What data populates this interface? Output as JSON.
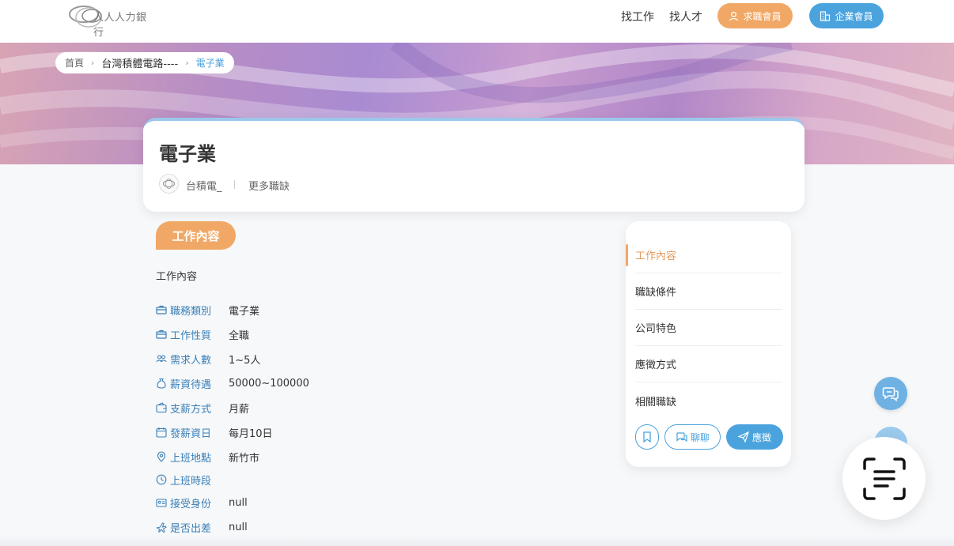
{
  "header": {
    "logo_text": "人人人力銀行",
    "nav_find_job": "找工作",
    "nav_find_talent": "找人才",
    "btn_job_seeker": "求職會員",
    "btn_company": "企業會員"
  },
  "breadcrumb": {
    "home": "首頁",
    "company": "台灣積體電路----",
    "current": "電子業"
  },
  "job": {
    "title": "電子業",
    "company": "台積電_",
    "more_jobs": "更多職缺"
  },
  "section": {
    "tag": "工作內容",
    "subtitle": "工作內容"
  },
  "details": [
    {
      "label": "職務類別",
      "value": "電子業",
      "icon": "briefcase-icon"
    },
    {
      "label": "工作性質",
      "value": "全職",
      "icon": "briefcase-icon"
    },
    {
      "label": "需求人數",
      "value": "1~5人",
      "icon": "people-icon"
    },
    {
      "label": "薪資待遇",
      "value": "50000~100000",
      "icon": "money-bag-icon"
    },
    {
      "label": "支薪方式",
      "value": "月薪",
      "icon": "wallet-icon"
    },
    {
      "label": "發薪資日",
      "value": "每月10日",
      "icon": "calendar-icon"
    },
    {
      "label": "上班地點",
      "value": "新竹市",
      "icon": "location-pin-icon"
    },
    {
      "label": "上班時段",
      "value": "",
      "icon": "clock-icon"
    },
    {
      "label": "接受身份",
      "value": "null",
      "icon": "id-card-icon"
    },
    {
      "label": "是否出差",
      "value": "null",
      "icon": "airplane-icon"
    }
  ],
  "side_nav": {
    "items": [
      "工作內容",
      "職缺條件",
      "公司特色",
      "應徵方式",
      "相關職缺"
    ],
    "active_index": 0,
    "chat_label": "聊聊",
    "apply_label": "應徵"
  },
  "colors": {
    "accent_orange": "#f1a867",
    "accent_blue": "#4ba3de",
    "label_blue": "#3b7fb6"
  }
}
